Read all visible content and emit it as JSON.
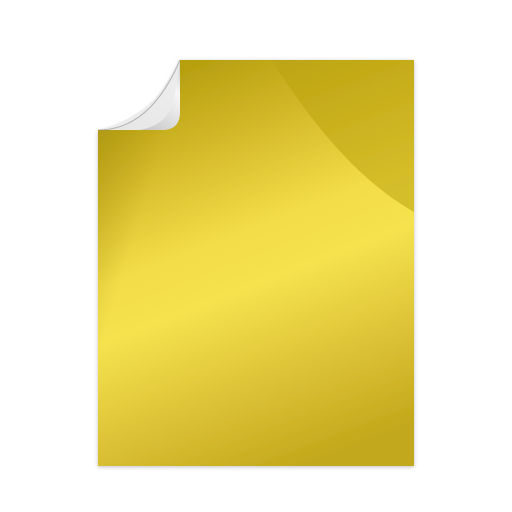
{
  "icon": {
    "name": "document-icon",
    "style": "gold glossy sheet with curled top-left corner",
    "colors": {
      "background": "#ffffff",
      "gold_dark": "#b9a20f",
      "gold_mid": "#d4ba28",
      "gold_light": "#f2dc4a",
      "curl_light": "#f4f4f4",
      "curl_dark": "#9a9a9a"
    }
  }
}
